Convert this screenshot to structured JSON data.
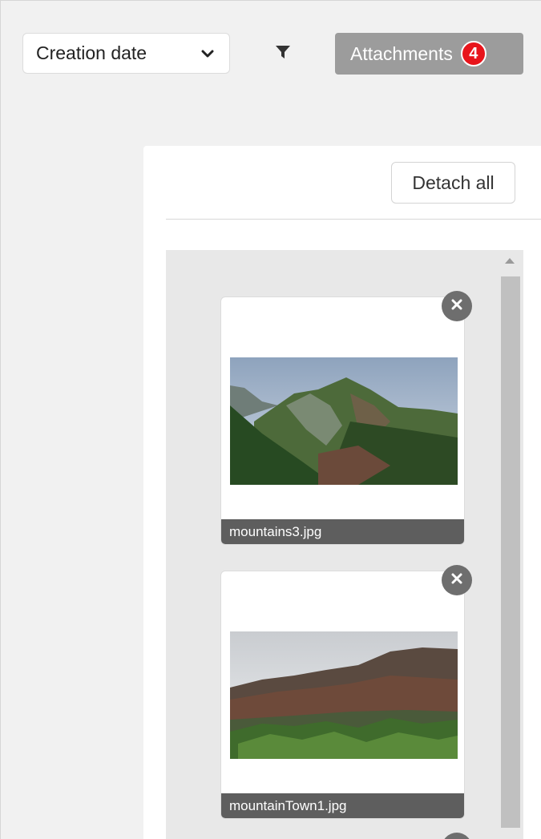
{
  "toolbar": {
    "sort_value": "Creation date",
    "attachments_label": "Attachments",
    "attachments_count": "4"
  },
  "panel": {
    "detach_all_label": "Detach all"
  },
  "attachments": [
    {
      "file_name": "mountains3.jpg"
    },
    {
      "file_name": "mountainTown1.jpg"
    }
  ],
  "colors": {
    "badge": "#e8141b",
    "attachments_button": "#9c9c9c",
    "caption_bar": "#5e5e5e"
  },
  "icons": {
    "sort_dropdown": "chevron-down-icon",
    "filter": "funnel-icon",
    "remove": "close-circle-icon"
  }
}
